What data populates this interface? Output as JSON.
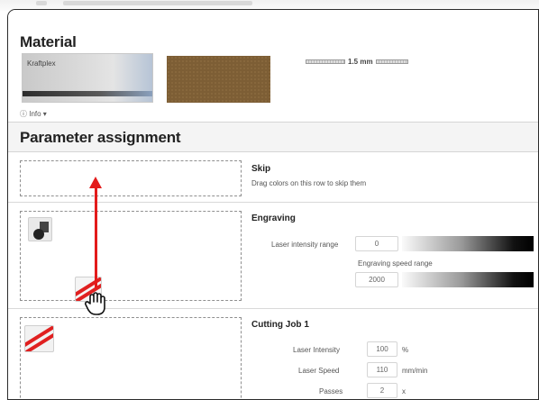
{
  "material": {
    "heading": "Material",
    "material_name": "Kraftplex",
    "thickness": "1.5 mm",
    "info_label": "Info ▾",
    "swatch_color": "#7d5e35"
  },
  "parameters": {
    "heading": "Parameter assignment",
    "skip": {
      "title": "Skip",
      "description": "Drag colors on this row to skip them"
    },
    "engraving": {
      "title": "Engraving",
      "laser_intensity_label": "Laser intensity range",
      "laser_intensity_value": "0",
      "speed_label": "Engraving speed range",
      "speed_value": "2000"
    },
    "cutting": {
      "title": "Cutting Job 1",
      "laser_intensity_label": "Laser Intensity",
      "laser_intensity_value": "100",
      "laser_intensity_unit": "%",
      "laser_speed_label": "Laser Speed",
      "laser_speed_value": "110",
      "laser_speed_unit": "mm/min",
      "passes_label": "Passes",
      "passes_value": "2",
      "passes_unit": "x"
    }
  },
  "colors": {
    "accent_red": "#e31b1b",
    "cut_line_red": "#e02020"
  }
}
